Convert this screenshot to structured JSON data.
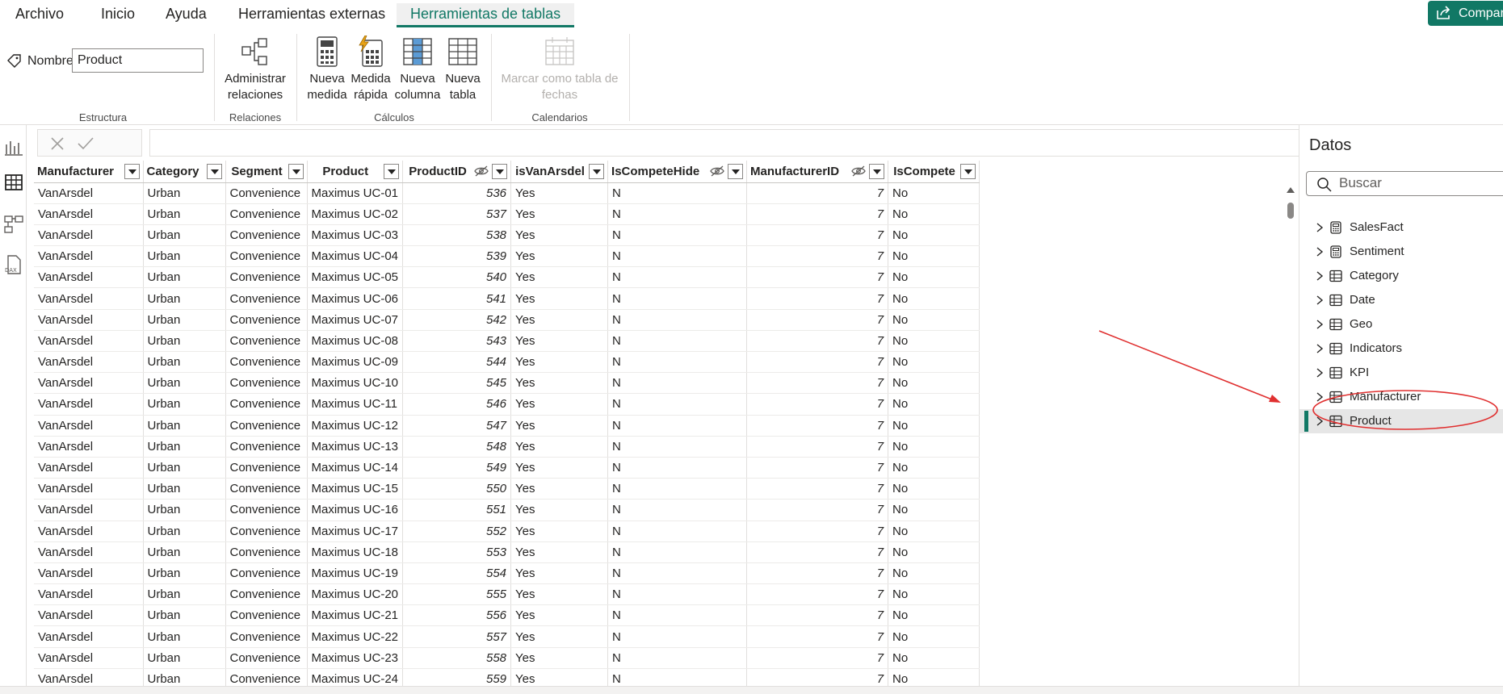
{
  "menu": {
    "items": [
      "Archivo",
      "Inicio",
      "Ayuda",
      "Herramientas externas",
      "Herramientas de tablas"
    ],
    "active": "Herramientas de tablas",
    "share_label": "Compar"
  },
  "ribbon": {
    "name_label": "Nombre",
    "name_value": "Product",
    "groups": {
      "estructura": "Estructura",
      "relaciones": "Relaciones",
      "calculos": "Cálculos",
      "calendarios": "Calendarios"
    },
    "buttons": {
      "admin_rel_1": "Administrar",
      "admin_rel_2": "relaciones",
      "nueva_medida_1": "Nueva",
      "nueva_medida_2": "medida",
      "medida_rapida_1": "Medida",
      "medida_rapida_2": "rápida",
      "nueva_columna_1": "Nueva",
      "nueva_columna_2": "columna",
      "nueva_tabla_1": "Nueva",
      "nueva_tabla_2": "tabla",
      "marcar_1": "Marcar como tabla de",
      "marcar_2": "fechas"
    }
  },
  "table": {
    "columns": [
      {
        "name": "Manufacturer",
        "hidden": false
      },
      {
        "name": "Category",
        "hidden": false
      },
      {
        "name": "Segment",
        "hidden": false
      },
      {
        "name": "Product",
        "hidden": false
      },
      {
        "name": "ProductID",
        "hidden": true
      },
      {
        "name": "isVanArsdel",
        "hidden": false
      },
      {
        "name": "IsCompeteHide",
        "hidden": true
      },
      {
        "name": "ManufacturerID",
        "hidden": true
      },
      {
        "name": "IsCompete",
        "hidden": false
      }
    ],
    "rows": [
      [
        "VanArsdel",
        "Urban",
        "Convenience",
        "Maximus UC-01",
        "536",
        "Yes",
        "N",
        "7",
        "No"
      ],
      [
        "VanArsdel",
        "Urban",
        "Convenience",
        "Maximus UC-02",
        "537",
        "Yes",
        "N",
        "7",
        "No"
      ],
      [
        "VanArsdel",
        "Urban",
        "Convenience",
        "Maximus UC-03",
        "538",
        "Yes",
        "N",
        "7",
        "No"
      ],
      [
        "VanArsdel",
        "Urban",
        "Convenience",
        "Maximus UC-04",
        "539",
        "Yes",
        "N",
        "7",
        "No"
      ],
      [
        "VanArsdel",
        "Urban",
        "Convenience",
        "Maximus UC-05",
        "540",
        "Yes",
        "N",
        "7",
        "No"
      ],
      [
        "VanArsdel",
        "Urban",
        "Convenience",
        "Maximus UC-06",
        "541",
        "Yes",
        "N",
        "7",
        "No"
      ],
      [
        "VanArsdel",
        "Urban",
        "Convenience",
        "Maximus UC-07",
        "542",
        "Yes",
        "N",
        "7",
        "No"
      ],
      [
        "VanArsdel",
        "Urban",
        "Convenience",
        "Maximus UC-08",
        "543",
        "Yes",
        "N",
        "7",
        "No"
      ],
      [
        "VanArsdel",
        "Urban",
        "Convenience",
        "Maximus UC-09",
        "544",
        "Yes",
        "N",
        "7",
        "No"
      ],
      [
        "VanArsdel",
        "Urban",
        "Convenience",
        "Maximus UC-10",
        "545",
        "Yes",
        "N",
        "7",
        "No"
      ],
      [
        "VanArsdel",
        "Urban",
        "Convenience",
        "Maximus UC-11",
        "546",
        "Yes",
        "N",
        "7",
        "No"
      ],
      [
        "VanArsdel",
        "Urban",
        "Convenience",
        "Maximus UC-12",
        "547",
        "Yes",
        "N",
        "7",
        "No"
      ],
      [
        "VanArsdel",
        "Urban",
        "Convenience",
        "Maximus UC-13",
        "548",
        "Yes",
        "N",
        "7",
        "No"
      ],
      [
        "VanArsdel",
        "Urban",
        "Convenience",
        "Maximus UC-14",
        "549",
        "Yes",
        "N",
        "7",
        "No"
      ],
      [
        "VanArsdel",
        "Urban",
        "Convenience",
        "Maximus UC-15",
        "550",
        "Yes",
        "N",
        "7",
        "No"
      ],
      [
        "VanArsdel",
        "Urban",
        "Convenience",
        "Maximus UC-16",
        "551",
        "Yes",
        "N",
        "7",
        "No"
      ],
      [
        "VanArsdel",
        "Urban",
        "Convenience",
        "Maximus UC-17",
        "552",
        "Yes",
        "N",
        "7",
        "No"
      ],
      [
        "VanArsdel",
        "Urban",
        "Convenience",
        "Maximus UC-18",
        "553",
        "Yes",
        "N",
        "7",
        "No"
      ],
      [
        "VanArsdel",
        "Urban",
        "Convenience",
        "Maximus UC-19",
        "554",
        "Yes",
        "N",
        "7",
        "No"
      ],
      [
        "VanArsdel",
        "Urban",
        "Convenience",
        "Maximus UC-20",
        "555",
        "Yes",
        "N",
        "7",
        "No"
      ],
      [
        "VanArsdel",
        "Urban",
        "Convenience",
        "Maximus UC-21",
        "556",
        "Yes",
        "N",
        "7",
        "No"
      ],
      [
        "VanArsdel",
        "Urban",
        "Convenience",
        "Maximus UC-22",
        "557",
        "Yes",
        "N",
        "7",
        "No"
      ],
      [
        "VanArsdel",
        "Urban",
        "Convenience",
        "Maximus UC-23",
        "558",
        "Yes",
        "N",
        "7",
        "No"
      ],
      [
        "VanArsdel",
        "Urban",
        "Convenience",
        "Maximus UC-24",
        "559",
        "Yes",
        "N",
        "7",
        "No"
      ]
    ]
  },
  "data_pane": {
    "title": "Datos",
    "search_placeholder": "Buscar",
    "tables": [
      {
        "name": "SalesFact",
        "icon": "calculator-table-icon"
      },
      {
        "name": "Sentiment",
        "icon": "calculator-table-icon"
      },
      {
        "name": "Category",
        "icon": "table-icon"
      },
      {
        "name": "Date",
        "icon": "table-icon"
      },
      {
        "name": "Geo",
        "icon": "table-icon"
      },
      {
        "name": "Indicators",
        "icon": "table-icon"
      },
      {
        "name": "KPI",
        "icon": "table-icon"
      },
      {
        "name": "Manufacturer",
        "icon": "table-icon"
      },
      {
        "name": "Product",
        "icon": "table-icon"
      }
    ],
    "selected": "Product"
  },
  "colors": {
    "accent": "#117865",
    "annotation": "#e03030"
  }
}
